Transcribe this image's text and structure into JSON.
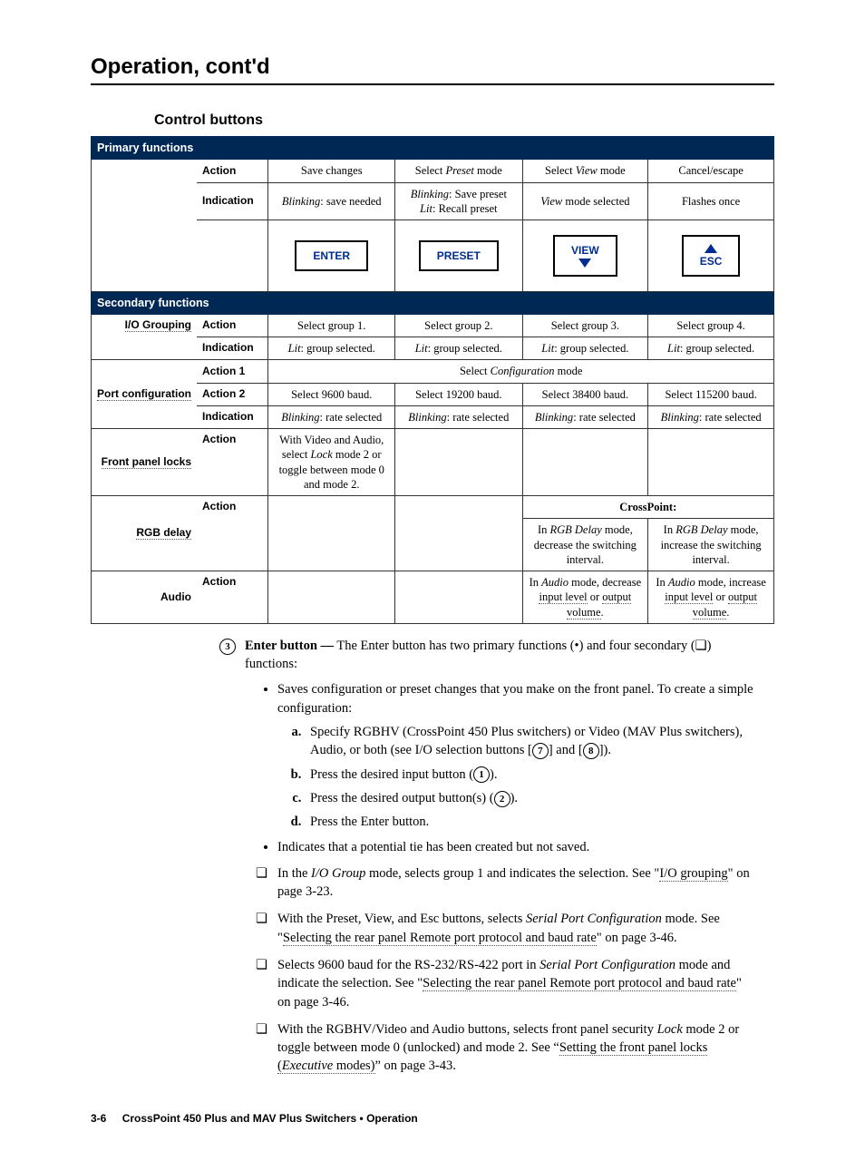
{
  "page_title": "Operation, cont'd",
  "section_title": "Control buttons",
  "table": {
    "primary_header": "Primary functions",
    "secondary_header": "Secondary functions",
    "row_action": "Action",
    "row_indication": "Indication",
    "row_action1": "Action 1",
    "row_action2": "Action 2",
    "io_grouping": "I/O Grouping",
    "port_config": "Port configuration",
    "front_panel": "Front panel locks",
    "rgb_delay": "RGB delay",
    "audio": "Audio",
    "crosspoint": "CrossPoint:",
    "primary_action": [
      "Save changes",
      {
        "pre": "Select ",
        "em": "Preset",
        "post": " mode"
      },
      {
        "pre": "Select ",
        "em": "View",
        "post": " mode"
      },
      "Cancel/escape"
    ],
    "primary_indication": [
      {
        "em": "Blinking",
        "post": ": save needed"
      },
      {
        "em1": "Blinking",
        "t1": ": Save preset",
        "em2": "Lit",
        "t2": ": Recall preset"
      },
      {
        "em": "View",
        "post": " mode selected"
      },
      "Flashes once"
    ],
    "buttons": [
      "ENTER",
      "PRESET",
      "VIEW",
      "ESC"
    ],
    "io_action": [
      "Select group 1.",
      "Select group 2.",
      "Select group 3.",
      "Select group 4."
    ],
    "io_ind": [
      {
        "em": "Lit",
        "post": ": group selected."
      },
      {
        "em": "Lit",
        "post": ": group selected."
      },
      {
        "em": "Lit",
        "post": ": group selected."
      },
      {
        "em": "Lit",
        "post": ": group selected."
      }
    ],
    "port_a1": {
      "pre": "Select ",
      "em": "Configuration",
      "post": " mode"
    },
    "port_a2": [
      "Select 9600 baud.",
      "Select 19200 baud.",
      "Select 38400 baud.",
      "Select 115200 baud."
    ],
    "port_ind": [
      {
        "em": "Blinking",
        "post": ": rate selected"
      },
      {
        "em": "Blinking",
        "post": ": rate selected"
      },
      {
        "em": "Blinking",
        "post": ": rate selected"
      },
      {
        "em": "Blinking",
        "post": ": rate selected"
      }
    ],
    "fp_action": {
      "pre": "With Video and Audio, select ",
      "em": "Lock",
      "post": " mode 2 or toggle between mode 0 and mode 2."
    },
    "rgb_view": {
      "pre": "In ",
      "em": "RGB Delay",
      "post": " mode, decrease the switching interval."
    },
    "rgb_esc": {
      "pre": "In ",
      "em": "RGB Delay",
      "post": " mode, increase the switching interval."
    },
    "audio_view_pre": "In ",
    "audio_view_em": "Audio",
    "audio_view_mid": " mode, decrease ",
    "audio_view_u1": "input level",
    "audio_view_or": " or ",
    "audio_view_u2": "output volume",
    "audio_view_end": ".",
    "audio_esc_pre": "In ",
    "audio_esc_em": "Audio",
    "audio_esc_mid": " mode, increase ",
    "audio_esc_u1": "input level",
    "audio_esc_or": " or ",
    "audio_esc_u2": "output volume",
    "audio_esc_end": "."
  },
  "circ3": "3",
  "lead_strong": "Enter button —",
  "lead_rest": " The Enter button has two primary functions (•) and four secondary (❏) functions:",
  "bullet1a": "Saves configuration or preset changes that you make on the front panel. To create a simple configuration:",
  "step_a_pre": "Specify RGBHV (CrossPoint 450 Plus switchers) or Video (MAV Plus switchers), Audio, or both (see I/O selection buttons [",
  "step_a_mid": "] and [",
  "step_a_end": "]).",
  "c7": "7",
  "c8": "8",
  "c1": "1",
  "c2": "2",
  "step_b_pre": "Press the desired input button (",
  "step_b_end": ").",
  "step_c_pre": "Press the desired output button(s) (",
  "step_c_end": ").",
  "step_d": "Press the Enter button.",
  "bullet2": "Indicates that a potential tie has been created but not saved.",
  "sq1_pre": "In the ",
  "sq1_em": "I/O Group",
  "sq1_mid": " mode, selects group 1 and indicates the selection.  See \"",
  "sq1_u": "I/O grouping",
  "sq1_end": "\" on page 3-23.",
  "sq2_pre": "With the Preset, View, and Esc buttons, selects ",
  "sq2_em": "Serial Port Configuration",
  "sq2_mid": " mode.  See \"",
  "sq2_u": "Selecting the rear panel Remote port protocol and baud rate",
  "sq2_end": "\" on page 3-46.",
  "sq3_pre": "Selects 9600 baud for the RS-232/RS-422 port in ",
  "sq3_em": "Serial Port Configuration",
  "sq3_mid": " mode and indicate the selection.  See \"",
  "sq3_u": "Selecting the rear panel Remote port protocol and baud rate",
  "sq3_end": "\" on page 3-46.",
  "sq4_pre": "With the RGBHV/Video and Audio buttons, selects front panel security ",
  "sq4_em": "Lock",
  "sq4_mid": " mode 2 or toggle between mode 0 (unlocked) and mode 2.  See “",
  "sq4_u_pre": "Setting the front panel locks (",
  "sq4_u_em": "Executive",
  "sq4_u_post": " modes)",
  "sq4_end": "” on page 3-43.",
  "footer_page": "3-6",
  "footer_text": "CrossPoint 450 Plus and MAV Plus Switchers • Operation"
}
